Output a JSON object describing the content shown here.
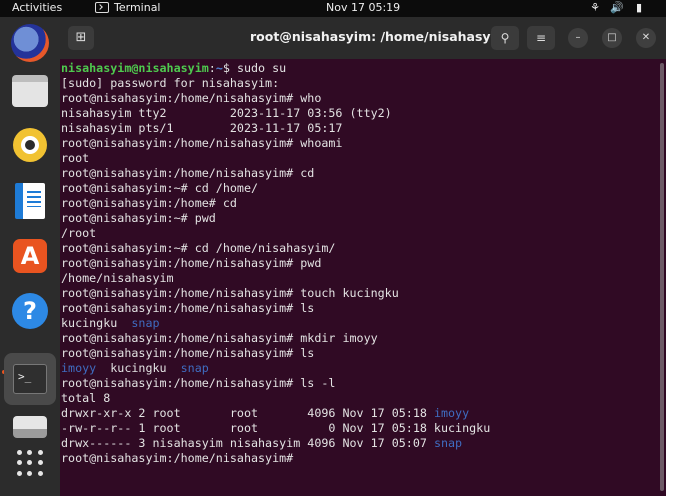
{
  "topbar": {
    "activities": "Activities",
    "app_name": "Terminal",
    "clock": "Nov 17  05:19",
    "network_icon": "network-icon",
    "volume_icon": "volume-icon",
    "battery_icon": "battery-icon"
  },
  "dock": {
    "items": [
      {
        "name": "firefox-icon"
      },
      {
        "name": "files-icon"
      },
      {
        "name": "rhythmbox-icon"
      },
      {
        "name": "libreoffice-writer-icon"
      },
      {
        "name": "app-center-icon"
      },
      {
        "name": "help-icon"
      },
      {
        "name": "terminal-icon",
        "active": true
      },
      {
        "name": "disk-icon"
      },
      {
        "name": "show-apps-icon"
      }
    ]
  },
  "window": {
    "title": "root@nisahasyim: /home/nisahasyim",
    "new_tab_icon": "new-tab-icon",
    "search_icon": "search-icon",
    "menu_icon": "hamburger-menu-icon",
    "minimize_icon": "minimize-icon",
    "maximize_icon": "maximize-icon",
    "close_icon": "close-icon"
  },
  "terminal": {
    "lines": [
      [
        {
          "t": "nisahasyim@nisahasyim",
          "c": "g"
        },
        {
          "t": ":",
          "c": "w"
        },
        {
          "t": "~",
          "c": "b"
        },
        {
          "t": "$ sudo su",
          "c": "w"
        }
      ],
      [
        {
          "t": "[sudo] password for nisahasyim:",
          "c": "w"
        }
      ],
      [
        {
          "t": "root@nisahasyim:/home/nisahasyim# who",
          "c": "w"
        }
      ],
      [
        {
          "t": "nisahasyim tty2         2023-11-17 03:56 (tty2)",
          "c": "w"
        }
      ],
      [
        {
          "t": "nisahasyim pts/1        2023-11-17 05:17",
          "c": "w"
        }
      ],
      [
        {
          "t": "root@nisahasyim:/home/nisahasyim# whoami",
          "c": "w"
        }
      ],
      [
        {
          "t": "root",
          "c": "w"
        }
      ],
      [
        {
          "t": "root@nisahasyim:/home/nisahasyim# cd",
          "c": "w"
        }
      ],
      [
        {
          "t": "root@nisahasyim:~# cd /home/",
          "c": "w"
        }
      ],
      [
        {
          "t": "root@nisahasyim:/home# cd",
          "c": "w"
        }
      ],
      [
        {
          "t": "root@nisahasyim:~# pwd",
          "c": "w"
        }
      ],
      [
        {
          "t": "/root",
          "c": "w"
        }
      ],
      [
        {
          "t": "root@nisahasyim:~# cd /home/nisahasyim/",
          "c": "w"
        }
      ],
      [
        {
          "t": "root@nisahasyim:/home/nisahasyim# pwd",
          "c": "w"
        }
      ],
      [
        {
          "t": "/home/nisahasyim",
          "c": "w"
        }
      ],
      [
        {
          "t": "root@nisahasyim:/home/nisahasyim# touch kucingku",
          "c": "w"
        }
      ],
      [
        {
          "t": "root@nisahasyim:/home/nisahasyim# ls",
          "c": "w"
        }
      ],
      [
        {
          "t": "kucingku  ",
          "c": "w"
        },
        {
          "t": "snap",
          "c": "bl"
        }
      ],
      [
        {
          "t": "root@nisahasyim:/home/nisahasyim# mkdir imoyy",
          "c": "w"
        }
      ],
      [
        {
          "t": "root@nisahasyim:/home/nisahasyim# ls",
          "c": "w"
        }
      ],
      [
        {
          "t": "imoyy",
          "c": "bl"
        },
        {
          "t": "  kucingku  ",
          "c": "w"
        },
        {
          "t": "snap",
          "c": "bl"
        }
      ],
      [
        {
          "t": "root@nisahasyim:/home/nisahasyim# ls -l",
          "c": "w"
        }
      ],
      [
        {
          "t": "total 8",
          "c": "w"
        }
      ],
      [
        {
          "t": "drwxr-xr-x 2 root       root       4096 Nov 17 05:18 ",
          "c": "w"
        },
        {
          "t": "imoyy",
          "c": "bl"
        }
      ],
      [
        {
          "t": "-rw-r--r-- 1 root       root          0 Nov 17 05:18 kucingku",
          "c": "w"
        }
      ],
      [
        {
          "t": "drwx------ 3 nisahasyim nisahasyim 4096 Nov 17 05:07 ",
          "c": "w"
        },
        {
          "t": "snap",
          "c": "bl"
        }
      ],
      [
        {
          "t": "root@nisahasyim:/home/nisahasyim# ",
          "c": "w"
        }
      ]
    ]
  },
  "colors": {
    "terminal_bg": "#300a24",
    "prompt_green": "#4ec94e",
    "dir_blue": "#3f6cc0",
    "accent": "#e95420"
  }
}
